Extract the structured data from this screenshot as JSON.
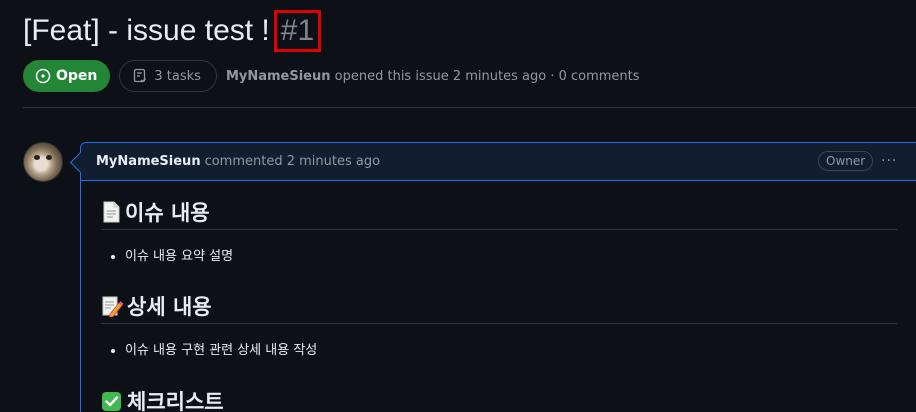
{
  "issue": {
    "title": "[Feat] - issue test !",
    "number": "#1",
    "state": "Open",
    "tasks": "3 tasks",
    "author": "MyNameSieun",
    "meta": "opened this issue 2 minutes ago · 0 comments"
  },
  "comment": {
    "author": "MyNameSieun",
    "action": "commented 2 minutes ago",
    "role": "Owner",
    "menu": "···",
    "sections": [
      {
        "icon": "page-facing-up-icon",
        "heading": "이슈 내용",
        "items": [
          "이슈 내용 요약 설명"
        ]
      },
      {
        "icon": "memo-pencil-icon",
        "heading": "상세 내용",
        "items": [
          "이슈 내용 구현 관련 상세 내용 작성"
        ]
      },
      {
        "icon": "check-mark-button-icon",
        "heading": "체크리스트",
        "items": []
      }
    ]
  },
  "colors": {
    "background": "#0d1117",
    "open_badge": "#238636",
    "comment_border": "#1f6feb",
    "comment_header": "#121d2f",
    "highlight_box": "#e00000"
  }
}
